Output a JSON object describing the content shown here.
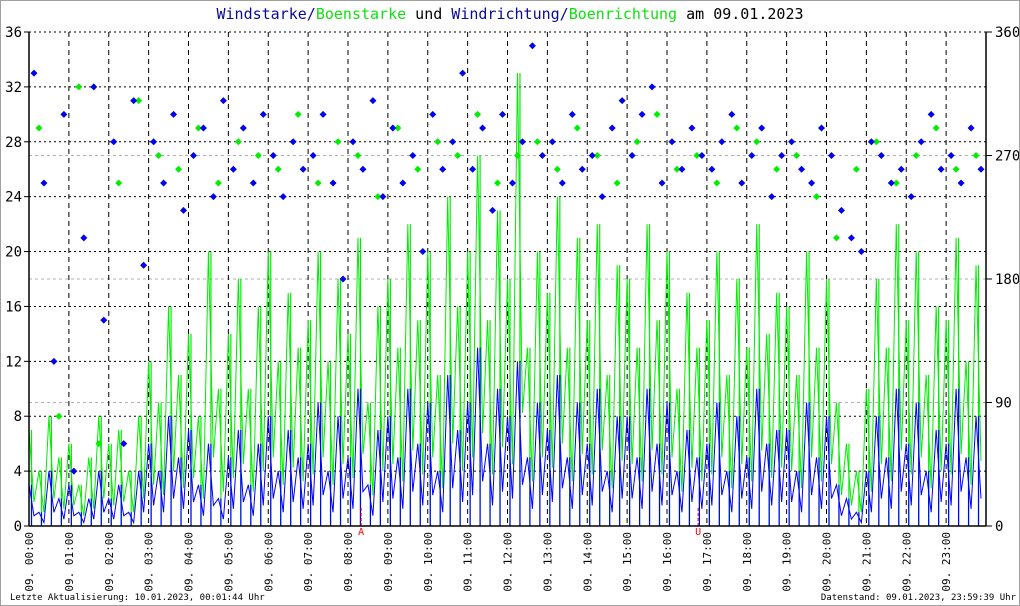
{
  "chart_data": {
    "type": "line",
    "title_parts": {
      "speed": "Windstarke",
      "sep1": "/",
      "gust": "Boenstarke",
      "and": " und ",
      "dir": "Windrichtung",
      "sep2": "/",
      "gustdir": "Boenrichtung",
      "date": " am 09.01.2023"
    },
    "x_unit": "hours of day",
    "x_range": [
      0,
      24
    ],
    "x_tick_labels": [
      "09. 00:00",
      "09. 01:00",
      "09. 02:00",
      "09. 03:00",
      "09. 04:00",
      "09. 05:00",
      "09. 06:00",
      "09. 07:00",
      "09. 08:00",
      "09. 09:00",
      "09. 10:00",
      "09. 11:00",
      "09. 12:00",
      "09. 13:00",
      "09. 14:00",
      "09. 15:00",
      "09. 16:00",
      "09. 17:00",
      "09. 18:00",
      "09. 19:00",
      "09. 20:00",
      "09. 21:00",
      "09. 22:00",
      "09. 23:00"
    ],
    "y_left": {
      "range": [
        0,
        36
      ],
      "ticks": [
        "0",
        "4",
        "8",
        "12",
        "16",
        "20",
        "24",
        "28",
        "32",
        "36"
      ]
    },
    "y_right": {
      "range": [
        0,
        360
      ],
      "ticks": [
        "0",
        "90",
        "180",
        "270",
        "360"
      ]
    },
    "grid": true,
    "annotations": [
      {
        "label": "A",
        "hour": 8.33,
        "color": "#ff0000"
      },
      {
        "label": "U",
        "hour": 16.78,
        "color": "#ff0000"
      }
    ],
    "series": [
      {
        "name": "Windstarke",
        "axis": "left",
        "kind": "line",
        "color": "#0000ff",
        "interval_min": 15,
        "values": [
          3,
          1,
          4,
          2,
          3,
          1,
          2,
          4,
          2,
          3,
          1,
          4,
          6,
          4,
          8,
          5,
          7,
          3,
          6,
          2,
          5,
          7,
          3,
          6,
          8,
          4,
          7,
          5,
          6,
          9,
          4,
          8,
          5,
          10,
          3,
          7,
          8,
          5,
          10,
          6,
          9,
          4,
          11,
          7,
          9,
          13,
          6,
          10,
          8,
          12,
          5,
          9,
          7,
          11,
          5,
          9,
          6,
          10,
          4,
          8,
          8,
          5,
          10,
          6,
          9,
          4,
          7,
          5,
          6,
          9,
          4,
          8,
          5,
          10,
          6,
          7,
          7,
          4,
          9,
          5,
          8,
          3,
          2,
          1,
          4,
          8,
          5,
          10,
          6,
          9,
          4,
          7,
          6,
          10,
          5,
          8
        ]
      },
      {
        "name": "Boenstarke",
        "axis": "left",
        "kind": "line",
        "color": "#00ee00",
        "interval_min": 15,
        "values": [
          7,
          4,
          8,
          5,
          6,
          3,
          5,
          8,
          6,
          7,
          4,
          8,
          12,
          9,
          16,
          11,
          14,
          8,
          20,
          10,
          14,
          18,
          10,
          16,
          20,
          12,
          17,
          13,
          15,
          20,
          12,
          18,
          14,
          21,
          9,
          16,
          18,
          13,
          22,
          15,
          20,
          11,
          24,
          16,
          20,
          27,
          15,
          23,
          18,
          33,
          13,
          20,
          17,
          24,
          13,
          21,
          15,
          22,
          11,
          19,
          18,
          13,
          22,
          15,
          20,
          10,
          17,
          13,
          15,
          20,
          11,
          18,
          13,
          22,
          14,
          17,
          16,
          11,
          20,
          13,
          18,
          9,
          6,
          4,
          10,
          18,
          13,
          22,
          15,
          20,
          11,
          16,
          15,
          21,
          12,
          19
        ]
      },
      {
        "name": "Windrichtung",
        "axis": "right",
        "kind": "scatter",
        "color": "#0000ee",
        "interval_min": 15,
        "values": [
          330,
          250,
          120,
          300,
          40,
          210,
          320,
          150,
          280,
          60,
          310,
          190,
          280,
          250,
          300,
          230,
          270,
          290,
          240,
          310,
          260,
          290,
          250,
          300,
          270,
          240,
          280,
          260,
          270,
          300,
          250,
          180,
          280,
          260,
          310,
          240,
          290,
          250,
          270,
          200,
          300,
          260,
          280,
          330,
          260,
          290,
          230,
          300,
          250,
          280,
          350,
          270,
          280,
          250,
          300,
          260,
          270,
          240,
          290,
          310,
          270,
          300,
          320,
          250,
          280,
          260,
          290,
          270,
          260,
          280,
          300,
          250,
          270,
          290,
          240,
          270,
          280,
          260,
          250,
          290,
          270,
          230,
          210,
          200,
          280,
          270,
          250,
          260,
          240,
          280,
          300,
          260,
          270,
          250,
          290,
          260
        ]
      },
      {
        "name": "Boenrichtung",
        "axis": "right",
        "kind": "scatter",
        "color": "#00ee00",
        "interval_min": 30,
        "values": [
          290,
          80,
          320,
          60,
          250,
          310,
          270,
          260,
          290,
          250,
          280,
          270,
          260,
          300,
          250,
          280,
          270,
          240,
          290,
          260,
          280,
          270,
          300,
          250,
          270,
          280,
          260,
          290,
          270,
          250,
          280,
          300,
          260,
          270,
          250,
          290,
          280,
          260,
          270,
          240,
          210,
          260,
          280,
          250,
          270,
          290,
          260,
          270
        ]
      }
    ]
  },
  "footer": {
    "last_update": "Letzte Aktualisierung: 10.01.2023, 00:01:44 Uhr",
    "data_state": "Datenstand: 09.01.2023, 23:59:39 Uhr"
  }
}
